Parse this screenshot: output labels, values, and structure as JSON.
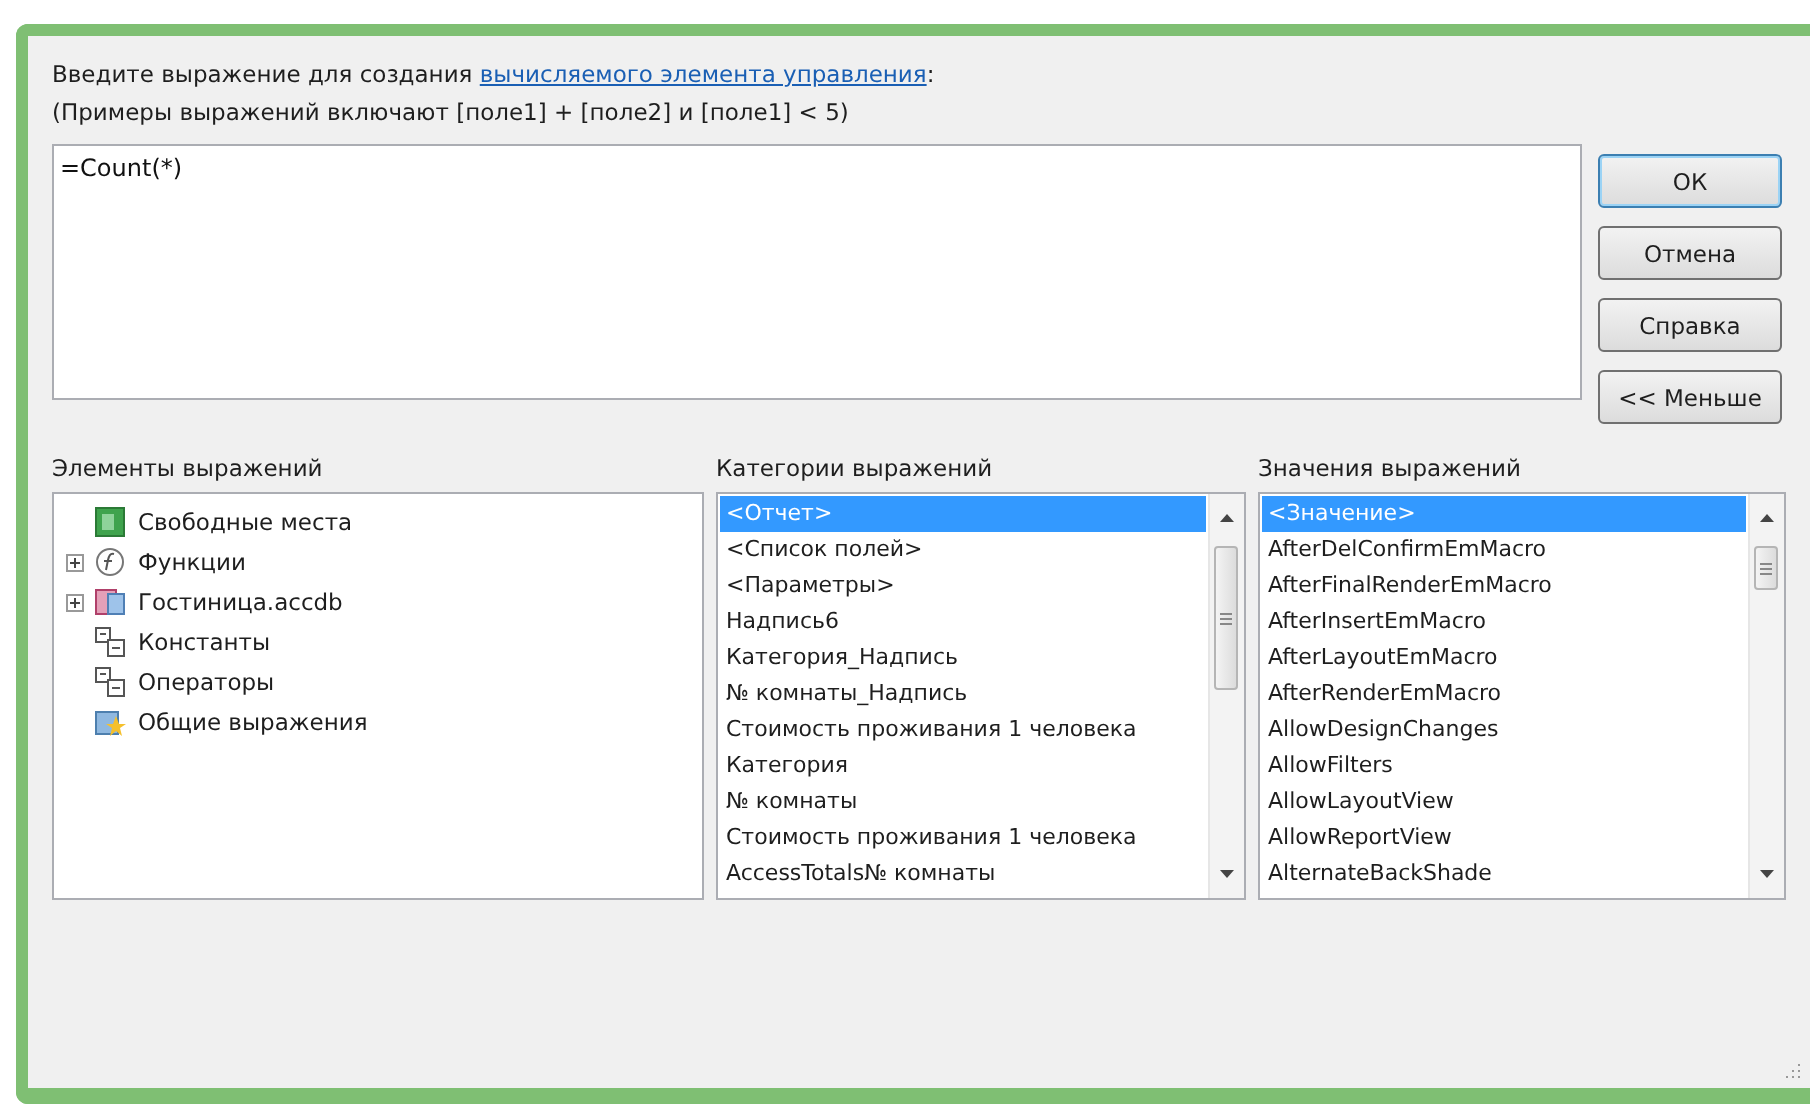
{
  "prompt": {
    "text": "Введите выражение для создания ",
    "link": "вычисляемого элемента управления",
    "suffix": ":"
  },
  "example": "(Примеры выражений включают [поле1] + [поле2] и [поле1] < 5)",
  "expression": {
    "value": "=Count(*)"
  },
  "buttons": [
    {
      "label": "ОК",
      "default": true
    },
    {
      "label": "Отмена",
      "default": false
    },
    {
      "label": "Справка",
      "default": false
    },
    {
      "label": "<< Меньше",
      "default": false
    }
  ],
  "elements": {
    "title": "Элементы выражений",
    "items": [
      {
        "label": "Свободные места",
        "kind": "form",
        "collapsed": false,
        "selected": false
      },
      {
        "label": "Функции",
        "kind": "function",
        "collapsed": true,
        "selected": false
      },
      {
        "label": "Гостиница.accdb",
        "kind": "database",
        "collapsed": true,
        "selected": false
      },
      {
        "label": "Константы",
        "kind": "group",
        "collapsed": false,
        "selected": false
      },
      {
        "label": "Операторы",
        "kind": "group",
        "collapsed": false,
        "selected": false
      },
      {
        "label": "Общие выражения",
        "kind": "common",
        "collapsed": false,
        "selected": false
      }
    ]
  },
  "categories": {
    "title": "Категории выражений",
    "items": [
      {
        "label": "<Отчет>",
        "selected": true
      },
      {
        "label": "<Список полей>",
        "selected": false
      },
      {
        "label": "<Параметры>",
        "selected": false
      },
      {
        "label": "Надпись6",
        "selected": false
      },
      {
        "label": "Категория_Надпись",
        "selected": false
      },
      {
        "label": "№ комнаты_Надпись",
        "selected": false
      },
      {
        "label": "Стоимость проживания 1 человека",
        "selected": false
      },
      {
        "label": "Категория",
        "selected": false
      },
      {
        "label": "№ комнаты",
        "selected": false
      },
      {
        "label": "Стоимость проживания 1 человека",
        "selected": false
      },
      {
        "label": "AccessTotals№ комнаты",
        "selected": false
      }
    ]
  },
  "values": {
    "title": "Значения выражений",
    "items": [
      {
        "label": "<Значение>",
        "selected": true
      },
      {
        "label": "AfterDelConfirmEmMacro",
        "selected": false
      },
      {
        "label": "AfterFinalRenderEmMacro",
        "selected": false
      },
      {
        "label": "AfterInsertEmMacro",
        "selected": false
      },
      {
        "label": "AfterLayoutEmMacro",
        "selected": false
      },
      {
        "label": "AfterRenderEmMacro",
        "selected": false
      },
      {
        "label": "AllowDesignChanges",
        "selected": false
      },
      {
        "label": "AllowFilters",
        "selected": false
      },
      {
        "label": "AllowLayoutView",
        "selected": false
      },
      {
        "label": "AllowReportView",
        "selected": false
      },
      {
        "label": "AlternateBackShade",
        "selected": false
      }
    ]
  }
}
